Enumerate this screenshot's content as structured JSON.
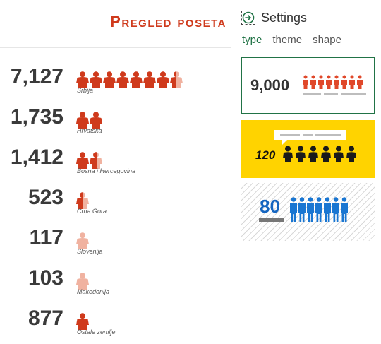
{
  "infographic": {
    "title": "Pregled poseta",
    "accent_color": "#cf3a1c",
    "light_color": "#f0b2a0",
    "rows": [
      {
        "value": "7,127",
        "label": "Srbija",
        "fill": 7.5
      },
      {
        "value": "1,735",
        "label": "Hrvatska",
        "fill": 2
      },
      {
        "value": "1,412",
        "label": "Bosna i Hercegovina",
        "fill": 1.6
      },
      {
        "value": "523",
        "label": "Crna Gora",
        "fill": 0.5
      },
      {
        "value": "117",
        "label": "Slovenija",
        "fill": 0
      },
      {
        "value": "103",
        "label": "Makedonija",
        "fill": 0
      },
      {
        "value": "877",
        "label": "Ostale zemlje",
        "fill": 1
      }
    ]
  },
  "settings": {
    "title": "Settings",
    "back_icon": "arrow-right-circle-icon",
    "tabs": [
      {
        "label": "type",
        "active": true
      },
      {
        "label": "theme",
        "active": false
      },
      {
        "label": "shape",
        "active": false
      }
    ],
    "options": [
      {
        "value": "9,000",
        "color": "#e0482a",
        "selected": true
      },
      {
        "value": "120",
        "color": "#1a1a1a",
        "selected": false
      },
      {
        "value": "80",
        "color": "#1565c0",
        "selected": false
      }
    ]
  }
}
